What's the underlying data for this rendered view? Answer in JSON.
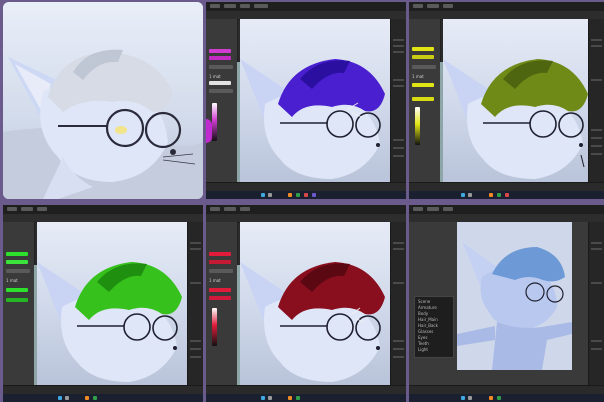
{
  "grid": {
    "panels": [
      {
        "id": "render",
        "kind": "plain",
        "hair_color": "#d6dbe6",
        "eye_color": "#f2e48a"
      },
      {
        "id": "purple",
        "kind": "app",
        "hair_color": "#4a1fd0",
        "accent": "#d23cd2",
        "swatch_colors": [
          "#d23cd2",
          "#c42bc4",
          "#7a2a7a"
        ]
      },
      {
        "id": "olive",
        "kind": "app",
        "hair_color": "#6f8a17",
        "accent": "#e1e514",
        "swatch_colors": [
          "#e1e514",
          "#c8cc12",
          "#d9dc10"
        ]
      },
      {
        "id": "green",
        "kind": "app",
        "hair_color": "#36c11c",
        "accent": "#2ce02c",
        "swatch_colors": [
          "#2ce02c",
          "#3ae23a",
          "#24b624"
        ]
      },
      {
        "id": "crimson",
        "kind": "app",
        "hair_color": "#8a0f1e",
        "accent": "#e01c3a",
        "swatch_colors": [
          "#e01c3a",
          "#c41a33",
          "#d11a3b"
        ]
      },
      {
        "id": "bodyview",
        "kind": "app",
        "hair_color": "#6d9ad6",
        "accent": "#3fa7e0"
      }
    ]
  },
  "panel_labels": {
    "mode_label": "1 mat",
    "outliner_items": [
      "Scene",
      "Armature",
      "Body",
      "Hair_Main",
      "Hair_Back",
      "Glasses",
      "Eyes",
      "Teeth",
      "Light"
    ]
  },
  "icons": {
    "blender": "blender-icon",
    "windows": "windows-icon",
    "search": "search-icon"
  }
}
